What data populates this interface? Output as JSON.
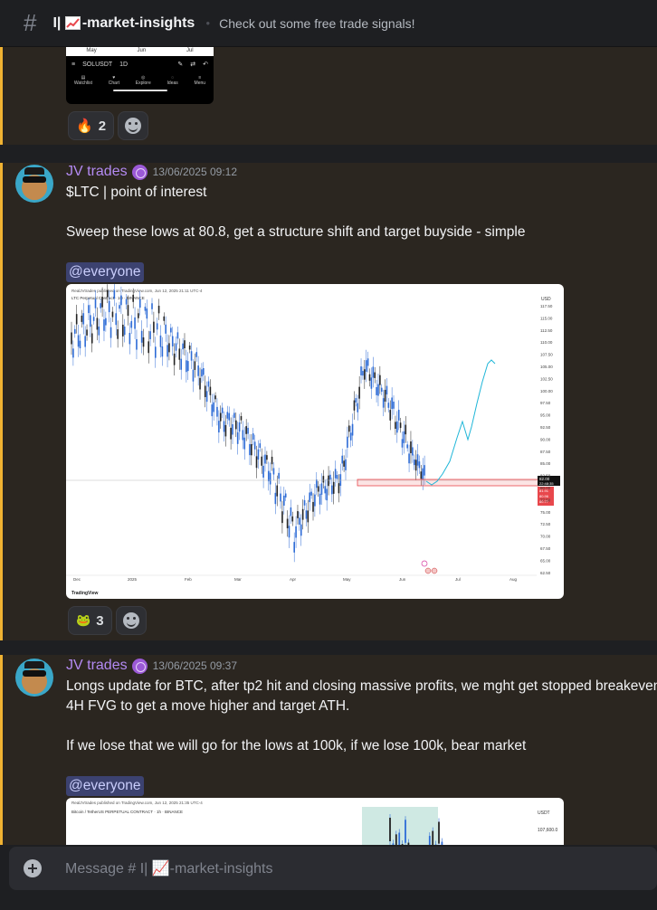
{
  "header": {
    "hash": "#",
    "channel": "-market-insights",
    "channel_prefix": "I|",
    "topic": "Check out some free trade signals!"
  },
  "msg1": {
    "phone": {
      "months": [
        "May",
        "Jun",
        "Jul"
      ],
      "symbol": "SOLUSDT",
      "interval": "1D",
      "nav": [
        "Watchlist",
        "Chart",
        "Explore",
        "Ideas",
        "Menu"
      ]
    },
    "reactions": [
      {
        "emoji": "🔥",
        "count": "2"
      }
    ]
  },
  "msg2": {
    "username": "JV trades",
    "timestamp": "13/06/2025 09:12",
    "line1": "$LTC | point of interest",
    "line2": "Sweep these lows at 80.8, get a structure shift and target buyside - simple",
    "mention": "@everyone",
    "reactions": [
      {
        "emoji": "🐸",
        "count": "3"
      }
    ],
    "chart": {
      "publisher": "RealJVtrades published on TradingView.com, Jun 12, 2025 21:11 UTC-4",
      "title": "LTC Perpetual Contract · 1D · BINANCE",
      "currency": "USD",
      "y_ticks": [
        "117.50",
        "115.00",
        "112.50",
        "110.00",
        "107.50",
        "105.00",
        "102.50",
        "100.00",
        "97.50",
        "95.00",
        "92.50",
        "90.00",
        "87.50",
        "85.00",
        "82.50",
        "80.00",
        "77.50",
        "75.00",
        "72.50",
        "70.00",
        "67.50",
        "65.00",
        "62.50"
      ],
      "x_ticks": [
        "Dec",
        "2025",
        "Feb",
        "Mar",
        "Apr",
        "May",
        "Jun",
        "Jul",
        "Aug"
      ],
      "price_tag": "82.00",
      "time_tag": "22:48:35",
      "red_tags": [
        "81.91",
        "80.96",
        "80.77"
      ],
      "brand": "TradingView"
    }
  },
  "msg3": {
    "username": "JV trades",
    "timestamp": "13/06/2025 09:37",
    "line1": "Longs update for BTC, after tp2 hit and closing massive profits, we mght get stopped breakeven o",
    "line2": "4H FVG to get a move higher and target ATH.",
    "line3": "If we lose that we will go for the lows at 100k, if we lose 100k, bear market",
    "mention": "@everyone",
    "chart": {
      "publisher": "RealJVtrades published on TradingView.com, Jun 12, 2025 21:35 UTC-4",
      "title": "Bitcoin / TetherUS PERPETUAL CONTRACT · 1h · BINANCE",
      "currency": "USDT",
      "y_tick": "107,600.0"
    }
  },
  "composer": {
    "placeholder": "Message # I| 📈-market-insights"
  },
  "colors": {
    "accent_mention": "#f0b232",
    "username": "#b38af2",
    "chart_line": "#2d6bd6",
    "projection": "#1fb6d8",
    "level_line": "#e8474c"
  }
}
